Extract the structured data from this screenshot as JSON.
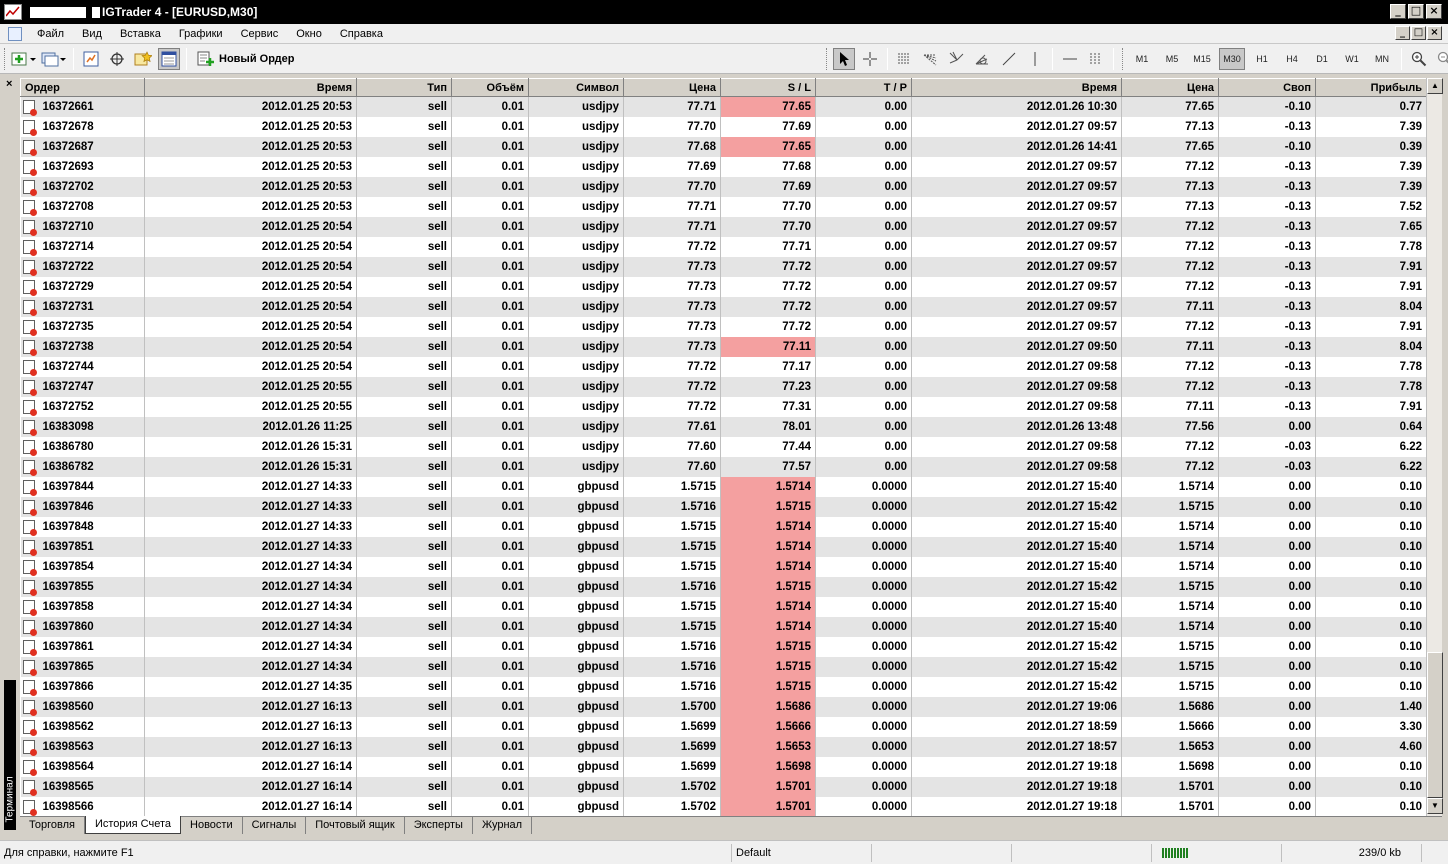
{
  "window": {
    "title": "IGTrader 4 - [EURUSD,M30]",
    "minimize": "_",
    "restore": "□",
    "close": "×"
  },
  "menu": [
    "Файл",
    "Вид",
    "Вставка",
    "Графики",
    "Сервис",
    "Окно",
    "Справка"
  ],
  "toolbar": {
    "new_order_label": "Новый Ордер",
    "timeframes": [
      "M1",
      "M5",
      "M15",
      "M30",
      "H1",
      "H4",
      "D1",
      "W1",
      "MN"
    ],
    "active_timeframe": "M30"
  },
  "terminal": {
    "close_label": "×",
    "side_label": "Терминал"
  },
  "columns": [
    "Ордер",
    "Время",
    "Тип",
    "Объём",
    "Символ",
    "Цена",
    "S / L",
    "T / P",
    "Время",
    "Цена",
    "Своп",
    "Прибыль"
  ],
  "rows": [
    {
      "order": "16372661",
      "open_time": "2012.01.25 20:53",
      "type": "sell",
      "volume": "0.01",
      "symbol": "usdjpy",
      "open_price": "77.71",
      "sl": "77.65",
      "sl_hit": true,
      "tp": "0.00",
      "close_time": "2012.01.26 10:30",
      "close_price": "77.65",
      "swap": "-0.10",
      "profit": "0.77"
    },
    {
      "order": "16372678",
      "open_time": "2012.01.25 20:53",
      "type": "sell",
      "volume": "0.01",
      "symbol": "usdjpy",
      "open_price": "77.70",
      "sl": "77.69",
      "sl_hit": false,
      "tp": "0.00",
      "close_time": "2012.01.27 09:57",
      "close_price": "77.13",
      "swap": "-0.13",
      "profit": "7.39"
    },
    {
      "order": "16372687",
      "open_time": "2012.01.25 20:53",
      "type": "sell",
      "volume": "0.01",
      "symbol": "usdjpy",
      "open_price": "77.68",
      "sl": "77.65",
      "sl_hit": true,
      "tp": "0.00",
      "close_time": "2012.01.26 14:41",
      "close_price": "77.65",
      "swap": "-0.10",
      "profit": "0.39"
    },
    {
      "order": "16372693",
      "open_time": "2012.01.25 20:53",
      "type": "sell",
      "volume": "0.01",
      "symbol": "usdjpy",
      "open_price": "77.69",
      "sl": "77.68",
      "sl_hit": false,
      "tp": "0.00",
      "close_time": "2012.01.27 09:57",
      "close_price": "77.12",
      "swap": "-0.13",
      "profit": "7.39"
    },
    {
      "order": "16372702",
      "open_time": "2012.01.25 20:53",
      "type": "sell",
      "volume": "0.01",
      "symbol": "usdjpy",
      "open_price": "77.70",
      "sl": "77.69",
      "sl_hit": false,
      "tp": "0.00",
      "close_time": "2012.01.27 09:57",
      "close_price": "77.13",
      "swap": "-0.13",
      "profit": "7.39"
    },
    {
      "order": "16372708",
      "open_time": "2012.01.25 20:53",
      "type": "sell",
      "volume": "0.01",
      "symbol": "usdjpy",
      "open_price": "77.71",
      "sl": "77.70",
      "sl_hit": false,
      "tp": "0.00",
      "close_time": "2012.01.27 09:57",
      "close_price": "77.13",
      "swap": "-0.13",
      "profit": "7.52"
    },
    {
      "order": "16372710",
      "open_time": "2012.01.25 20:54",
      "type": "sell",
      "volume": "0.01",
      "symbol": "usdjpy",
      "open_price": "77.71",
      "sl": "77.70",
      "sl_hit": false,
      "tp": "0.00",
      "close_time": "2012.01.27 09:57",
      "close_price": "77.12",
      "swap": "-0.13",
      "profit": "7.65"
    },
    {
      "order": "16372714",
      "open_time": "2012.01.25 20:54",
      "type": "sell",
      "volume": "0.01",
      "symbol": "usdjpy",
      "open_price": "77.72",
      "sl": "77.71",
      "sl_hit": false,
      "tp": "0.00",
      "close_time": "2012.01.27 09:57",
      "close_price": "77.12",
      "swap": "-0.13",
      "profit": "7.78"
    },
    {
      "order": "16372722",
      "open_time": "2012.01.25 20:54",
      "type": "sell",
      "volume": "0.01",
      "symbol": "usdjpy",
      "open_price": "77.73",
      "sl": "77.72",
      "sl_hit": false,
      "tp": "0.00",
      "close_time": "2012.01.27 09:57",
      "close_price": "77.12",
      "swap": "-0.13",
      "profit": "7.91"
    },
    {
      "order": "16372729",
      "open_time": "2012.01.25 20:54",
      "type": "sell",
      "volume": "0.01",
      "symbol": "usdjpy",
      "open_price": "77.73",
      "sl": "77.72",
      "sl_hit": false,
      "tp": "0.00",
      "close_time": "2012.01.27 09:57",
      "close_price": "77.12",
      "swap": "-0.13",
      "profit": "7.91"
    },
    {
      "order": "16372731",
      "open_time": "2012.01.25 20:54",
      "type": "sell",
      "volume": "0.01",
      "symbol": "usdjpy",
      "open_price": "77.73",
      "sl": "77.72",
      "sl_hit": false,
      "tp": "0.00",
      "close_time": "2012.01.27 09:57",
      "close_price": "77.11",
      "swap": "-0.13",
      "profit": "8.04"
    },
    {
      "order": "16372735",
      "open_time": "2012.01.25 20:54",
      "type": "sell",
      "volume": "0.01",
      "symbol": "usdjpy",
      "open_price": "77.73",
      "sl": "77.72",
      "sl_hit": false,
      "tp": "0.00",
      "close_time": "2012.01.27 09:57",
      "close_price": "77.12",
      "swap": "-0.13",
      "profit": "7.91"
    },
    {
      "order": "16372738",
      "open_time": "2012.01.25 20:54",
      "type": "sell",
      "volume": "0.01",
      "symbol": "usdjpy",
      "open_price": "77.73",
      "sl": "77.11",
      "sl_hit": true,
      "tp": "0.00",
      "close_time": "2012.01.27 09:50",
      "close_price": "77.11",
      "swap": "-0.13",
      "profit": "8.04"
    },
    {
      "order": "16372744",
      "open_time": "2012.01.25 20:54",
      "type": "sell",
      "volume": "0.01",
      "symbol": "usdjpy",
      "open_price": "77.72",
      "sl": "77.17",
      "sl_hit": false,
      "tp": "0.00",
      "close_time": "2012.01.27 09:58",
      "close_price": "77.12",
      "swap": "-0.13",
      "profit": "7.78"
    },
    {
      "order": "16372747",
      "open_time": "2012.01.25 20:55",
      "type": "sell",
      "volume": "0.01",
      "symbol": "usdjpy",
      "open_price": "77.72",
      "sl": "77.23",
      "sl_hit": false,
      "tp": "0.00",
      "close_time": "2012.01.27 09:58",
      "close_price": "77.12",
      "swap": "-0.13",
      "profit": "7.78"
    },
    {
      "order": "16372752",
      "open_time": "2012.01.25 20:55",
      "type": "sell",
      "volume": "0.01",
      "symbol": "usdjpy",
      "open_price": "77.72",
      "sl": "77.31",
      "sl_hit": false,
      "tp": "0.00",
      "close_time": "2012.01.27 09:58",
      "close_price": "77.11",
      "swap": "-0.13",
      "profit": "7.91"
    },
    {
      "order": "16383098",
      "open_time": "2012.01.26 11:25",
      "type": "sell",
      "volume": "0.01",
      "symbol": "usdjpy",
      "open_price": "77.61",
      "sl": "78.01",
      "sl_hit": false,
      "tp": "0.00",
      "close_time": "2012.01.26 13:48",
      "close_price": "77.56",
      "swap": "0.00",
      "profit": "0.64"
    },
    {
      "order": "16386780",
      "open_time": "2012.01.26 15:31",
      "type": "sell",
      "volume": "0.01",
      "symbol": "usdjpy",
      "open_price": "77.60",
      "sl": "77.44",
      "sl_hit": false,
      "tp": "0.00",
      "close_time": "2012.01.27 09:58",
      "close_price": "77.12",
      "swap": "-0.03",
      "profit": "6.22"
    },
    {
      "order": "16386782",
      "open_time": "2012.01.26 15:31",
      "type": "sell",
      "volume": "0.01",
      "symbol": "usdjpy",
      "open_price": "77.60",
      "sl": "77.57",
      "sl_hit": false,
      "tp": "0.00",
      "close_time": "2012.01.27 09:58",
      "close_price": "77.12",
      "swap": "-0.03",
      "profit": "6.22"
    },
    {
      "order": "16397844",
      "open_time": "2012.01.27 14:33",
      "type": "sell",
      "volume": "0.01",
      "symbol": "gbpusd",
      "open_price": "1.5715",
      "sl": "1.5714",
      "sl_hit": true,
      "tp": "0.0000",
      "close_time": "2012.01.27 15:40",
      "close_price": "1.5714",
      "swap": "0.00",
      "profit": "0.10"
    },
    {
      "order": "16397846",
      "open_time": "2012.01.27 14:33",
      "type": "sell",
      "volume": "0.01",
      "symbol": "gbpusd",
      "open_price": "1.5716",
      "sl": "1.5715",
      "sl_hit": true,
      "tp": "0.0000",
      "close_time": "2012.01.27 15:42",
      "close_price": "1.5715",
      "swap": "0.00",
      "profit": "0.10"
    },
    {
      "order": "16397848",
      "open_time": "2012.01.27 14:33",
      "type": "sell",
      "volume": "0.01",
      "symbol": "gbpusd",
      "open_price": "1.5715",
      "sl": "1.5714",
      "sl_hit": true,
      "tp": "0.0000",
      "close_time": "2012.01.27 15:40",
      "close_price": "1.5714",
      "swap": "0.00",
      "profit": "0.10"
    },
    {
      "order": "16397851",
      "open_time": "2012.01.27 14:33",
      "type": "sell",
      "volume": "0.01",
      "symbol": "gbpusd",
      "open_price": "1.5715",
      "sl": "1.5714",
      "sl_hit": true,
      "tp": "0.0000",
      "close_time": "2012.01.27 15:40",
      "close_price": "1.5714",
      "swap": "0.00",
      "profit": "0.10"
    },
    {
      "order": "16397854",
      "open_time": "2012.01.27 14:34",
      "type": "sell",
      "volume": "0.01",
      "symbol": "gbpusd",
      "open_price": "1.5715",
      "sl": "1.5714",
      "sl_hit": true,
      "tp": "0.0000",
      "close_time": "2012.01.27 15:40",
      "close_price": "1.5714",
      "swap": "0.00",
      "profit": "0.10"
    },
    {
      "order": "16397855",
      "open_time": "2012.01.27 14:34",
      "type": "sell",
      "volume": "0.01",
      "symbol": "gbpusd",
      "open_price": "1.5716",
      "sl": "1.5715",
      "sl_hit": true,
      "tp": "0.0000",
      "close_time": "2012.01.27 15:42",
      "close_price": "1.5715",
      "swap": "0.00",
      "profit": "0.10"
    },
    {
      "order": "16397858",
      "open_time": "2012.01.27 14:34",
      "type": "sell",
      "volume": "0.01",
      "symbol": "gbpusd",
      "open_price": "1.5715",
      "sl": "1.5714",
      "sl_hit": true,
      "tp": "0.0000",
      "close_time": "2012.01.27 15:40",
      "close_price": "1.5714",
      "swap": "0.00",
      "profit": "0.10"
    },
    {
      "order": "16397860",
      "open_time": "2012.01.27 14:34",
      "type": "sell",
      "volume": "0.01",
      "symbol": "gbpusd",
      "open_price": "1.5715",
      "sl": "1.5714",
      "sl_hit": true,
      "tp": "0.0000",
      "close_time": "2012.01.27 15:40",
      "close_price": "1.5714",
      "swap": "0.00",
      "profit": "0.10"
    },
    {
      "order": "16397861",
      "open_time": "2012.01.27 14:34",
      "type": "sell",
      "volume": "0.01",
      "symbol": "gbpusd",
      "open_price": "1.5716",
      "sl": "1.5715",
      "sl_hit": true,
      "tp": "0.0000",
      "close_time": "2012.01.27 15:42",
      "close_price": "1.5715",
      "swap": "0.00",
      "profit": "0.10"
    },
    {
      "order": "16397865",
      "open_time": "2012.01.27 14:34",
      "type": "sell",
      "volume": "0.01",
      "symbol": "gbpusd",
      "open_price": "1.5716",
      "sl": "1.5715",
      "sl_hit": true,
      "tp": "0.0000",
      "close_time": "2012.01.27 15:42",
      "close_price": "1.5715",
      "swap": "0.00",
      "profit": "0.10"
    },
    {
      "order": "16397866",
      "open_time": "2012.01.27 14:35",
      "type": "sell",
      "volume": "0.01",
      "symbol": "gbpusd",
      "open_price": "1.5716",
      "sl": "1.5715",
      "sl_hit": true,
      "tp": "0.0000",
      "close_time": "2012.01.27 15:42",
      "close_price": "1.5715",
      "swap": "0.00",
      "profit": "0.10"
    },
    {
      "order": "16398560",
      "open_time": "2012.01.27 16:13",
      "type": "sell",
      "volume": "0.01",
      "symbol": "gbpusd",
      "open_price": "1.5700",
      "sl": "1.5686",
      "sl_hit": true,
      "tp": "0.0000",
      "close_time": "2012.01.27 19:06",
      "close_price": "1.5686",
      "swap": "0.00",
      "profit": "1.40"
    },
    {
      "order": "16398562",
      "open_time": "2012.01.27 16:13",
      "type": "sell",
      "volume": "0.01",
      "symbol": "gbpusd",
      "open_price": "1.5699",
      "sl": "1.5666",
      "sl_hit": true,
      "tp": "0.0000",
      "close_time": "2012.01.27 18:59",
      "close_price": "1.5666",
      "swap": "0.00",
      "profit": "3.30"
    },
    {
      "order": "16398563",
      "open_time": "2012.01.27 16:13",
      "type": "sell",
      "volume": "0.01",
      "symbol": "gbpusd",
      "open_price": "1.5699",
      "sl": "1.5653",
      "sl_hit": true,
      "tp": "0.0000",
      "close_time": "2012.01.27 18:57",
      "close_price": "1.5653",
      "swap": "0.00",
      "profit": "4.60"
    },
    {
      "order": "16398564",
      "open_time": "2012.01.27 16:14",
      "type": "sell",
      "volume": "0.01",
      "symbol": "gbpusd",
      "open_price": "1.5699",
      "sl": "1.5698",
      "sl_hit": true,
      "tp": "0.0000",
      "close_time": "2012.01.27 19:18",
      "close_price": "1.5698",
      "swap": "0.00",
      "profit": "0.10"
    },
    {
      "order": "16398565",
      "open_time": "2012.01.27 16:14",
      "type": "sell",
      "volume": "0.01",
      "symbol": "gbpusd",
      "open_price": "1.5702",
      "sl": "1.5701",
      "sl_hit": true,
      "tp": "0.0000",
      "close_time": "2012.01.27 19:18",
      "close_price": "1.5701",
      "swap": "0.00",
      "profit": "0.10"
    },
    {
      "order": "16398566",
      "open_time": "2012.01.27 16:14",
      "type": "sell",
      "volume": "0.01",
      "symbol": "gbpusd",
      "open_price": "1.5702",
      "sl": "1.5701",
      "sl_hit": true,
      "tp": "0.0000",
      "close_time": "2012.01.27 19:18",
      "close_price": "1.5701",
      "swap": "0.00",
      "profit": "0.10"
    }
  ],
  "tabs": [
    "Торговля",
    "История Счета",
    "Новости",
    "Сигналы",
    "Почтовый ящик",
    "Эксперты",
    "Журнал"
  ],
  "active_tab": "История Счета",
  "colors": {
    "sl_hit": "#f4a0a0",
    "row_alt": "#e4e4e4"
  },
  "scrollbar": {
    "up": "▲",
    "down": "▼"
  },
  "status": {
    "help": "Для справки, нажмите F1",
    "profile": "Default",
    "traffic": "239/0 kb"
  }
}
